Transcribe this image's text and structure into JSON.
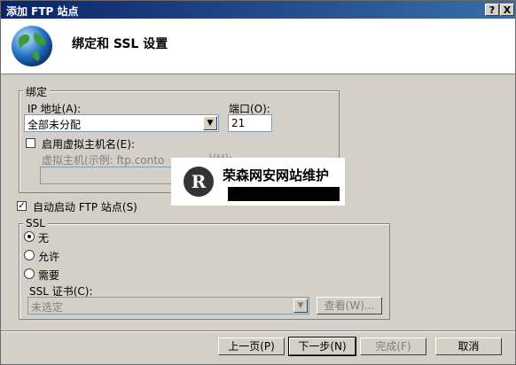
{
  "window": {
    "title": "添加 FTP 站点",
    "help_btn": "?",
    "close_btn": "X"
  },
  "header": {
    "title": "绑定和 SSL 设置",
    "icon": "globe-icon"
  },
  "binding": {
    "legend": "绑定",
    "ip_label": "IP 地址(A):",
    "ip_value": "全部未分配",
    "port_label": "端口(O):",
    "port_value": "21",
    "vhost_checkbox_label": "启用虚拟主机名(E):",
    "vhost_checked": false,
    "vhost_field_label": "虚拟主机(示例: ftp.conto",
    "vhost_field_label_tail": ")(H):",
    "vhost_value": ""
  },
  "autostart": {
    "label": "自动启动 FTP 站点(S)",
    "checked": true
  },
  "ssl": {
    "legend": "SSL",
    "options": [
      {
        "label": "无",
        "selected": true
      },
      {
        "label": "允许",
        "selected": false
      },
      {
        "label": "需要",
        "selected": false
      }
    ],
    "cert_label": "SSL 证书(C):",
    "cert_value": "未选定",
    "view_button": "查看(W)..."
  },
  "footer": {
    "prev": "上一页(P)",
    "next": "下一步(N)",
    "finish": "完成(F)",
    "cancel": "取消"
  },
  "watermark": {
    "logo_letter": "R",
    "text": "荣森网安网站维护"
  }
}
